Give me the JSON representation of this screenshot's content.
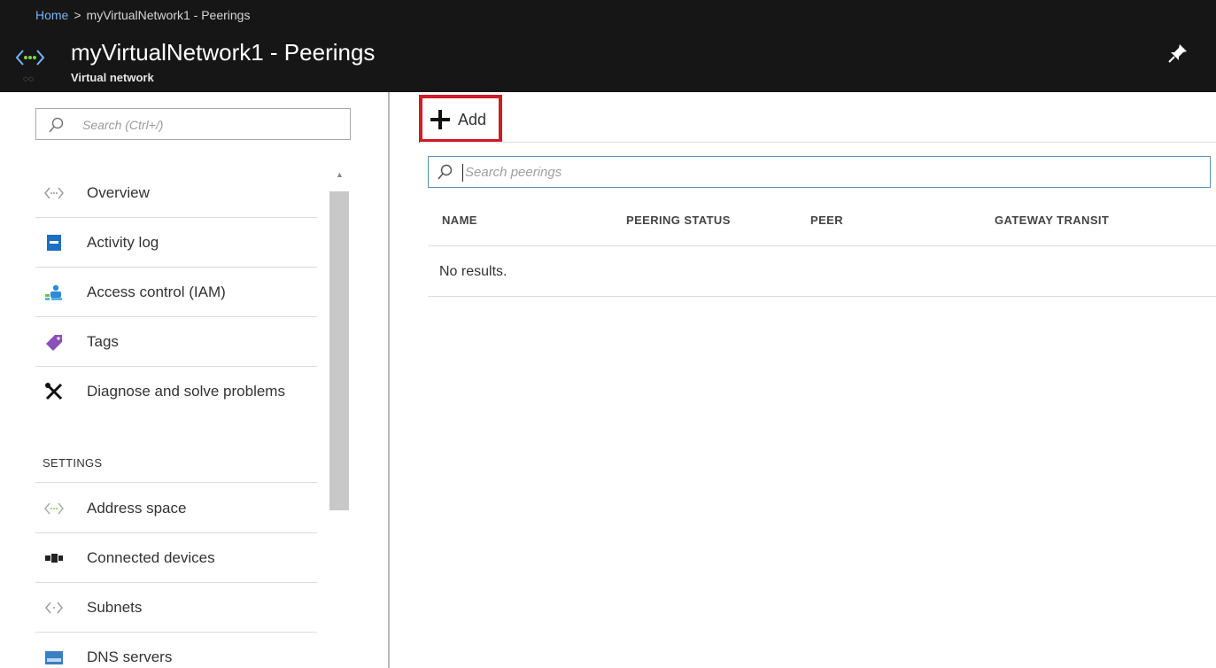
{
  "header": {
    "breadcrumb": {
      "home": "Home",
      "separator": ">",
      "current": "myVirtualNetwork1 - Peerings"
    },
    "title": "myVirtualNetwork1 - Peerings",
    "subtitle": "Virtual network",
    "icons": {
      "resource": "virtual-network-icon",
      "pin": "pin-icon"
    }
  },
  "sidebar": {
    "search_placeholder": "Search (Ctrl+/)",
    "items": [
      {
        "label": "Overview",
        "icon": "overview-icon"
      },
      {
        "label": "Activity log",
        "icon": "activity-log-icon"
      },
      {
        "label": "Access control (IAM)",
        "icon": "access-control-icon"
      },
      {
        "label": "Tags",
        "icon": "tag-icon"
      },
      {
        "label": "Diagnose and solve problems",
        "icon": "wrench-icon"
      }
    ],
    "section": "SETTINGS",
    "settings_items": [
      {
        "label": "Address space",
        "icon": "address-space-icon"
      },
      {
        "label": "Connected devices",
        "icon": "connected-devices-icon"
      },
      {
        "label": "Subnets",
        "icon": "subnets-icon"
      },
      {
        "label": "DNS servers",
        "icon": "dns-servers-icon"
      }
    ]
  },
  "main": {
    "add_label": "Add",
    "search_placeholder": "Search peerings",
    "columns": [
      "NAME",
      "PEERING STATUS",
      "PEER",
      "GATEWAY TRANSIT"
    ],
    "empty_message": "No results."
  },
  "colors": {
    "header_bg": "#161616",
    "link": "#6fb7ff",
    "highlight_border": "#d11a2a",
    "search_border": "#5d8fb0"
  }
}
